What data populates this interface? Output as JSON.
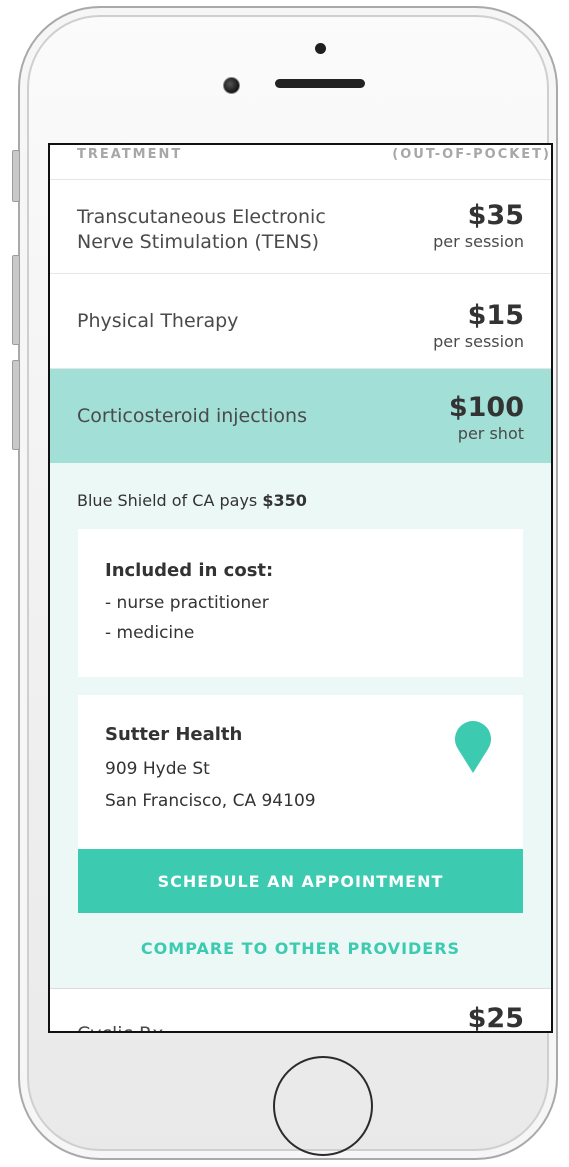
{
  "header": {
    "treatment_label": "TREATMENT",
    "cost_label": "(OUT-OF-POCKET)"
  },
  "treatments": [
    {
      "name_line1": "Transcutaneous Electronic",
      "name_line2": "Nerve Stimulation (TENS)",
      "price": "$35",
      "unit": "per session"
    },
    {
      "name": "Physical Therapy",
      "price": "$15",
      "unit": "per session"
    },
    {
      "name": "Corticosteroid injections",
      "price": "$100",
      "unit": "per shot",
      "selected": true
    },
    {
      "name": "Cyclic     Rx",
      "price": "$25"
    }
  ],
  "details": {
    "insurer_text": "Blue Shield of CA pays ",
    "insurer_amount": "$350",
    "included_title": "Included in cost:",
    "included_items": [
      "- nurse practitioner",
      "- medicine"
    ],
    "provider": {
      "name": "Sutter Health",
      "address_line1": "909 Hyde St",
      "address_line2": "San Francisco, CA 94109",
      "pin_icon": "map-pin-icon"
    },
    "schedule_label": "SCHEDULE AN APPOINTMENT",
    "compare_label": "COMPARE TO OTHER PROVIDERS"
  },
  "colors": {
    "accent": "#3ccab1",
    "selected_row": "#a2dfd6",
    "expanded_bg": "#ecf8f6"
  }
}
